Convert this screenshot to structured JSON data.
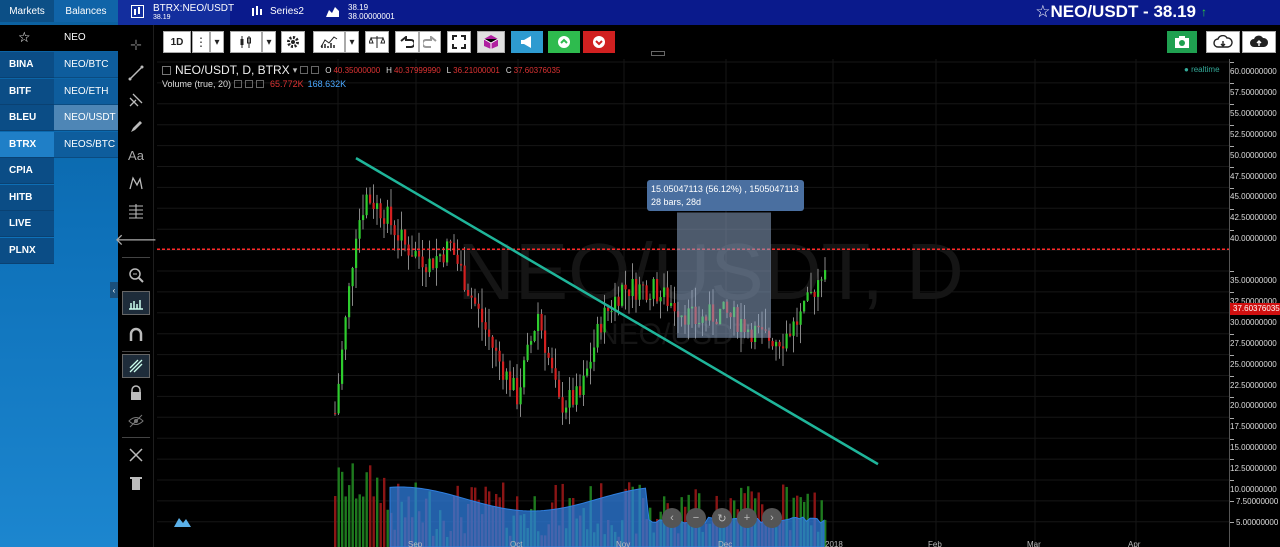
{
  "left_panel": {
    "tabs": [
      "Markets",
      "Balances"
    ],
    "favorites_label": "NEO",
    "exchanges": [
      "BINA",
      "BITF",
      "BLEU",
      "BTRX",
      "CPIA",
      "HITB",
      "LIVE",
      "PLNX"
    ],
    "selected_exchange": "BTRX",
    "pairs": [
      "NEO/BTC",
      "NEO/ETH",
      "NEO/USDT",
      "NEOS/BTC"
    ],
    "selected_pair": "NEO/USDT"
  },
  "top_bar": {
    "symbol_tab": {
      "name": "BTRX:NEO/USDT",
      "price": "38.19"
    },
    "series2_label": "Series2",
    "series3": {
      "value1": "38.19",
      "value2": "38.00000001"
    },
    "title": "NEO/USDT - 38.19"
  },
  "toolbar": {
    "interval": "1D"
  },
  "legend": {
    "symbol": "NEO/USDT, D, BTRX",
    "open_key": "O",
    "open": "40.35000000",
    "high_key": "H",
    "high": "40.37999990",
    "low_key": "L",
    "low": "36.21000001",
    "close_key": "C",
    "close": "37.60376035",
    "volume_label": "Volume (true, 20)",
    "volume_value1": "65.772K",
    "volume_value2": "168.632K"
  },
  "realtime_label": "realtime",
  "watermark": {
    "main": "NEO/USDT, D",
    "sub": "NEO/USDT"
  },
  "measure_tooltip": {
    "line1": "15.05047113 (56.12%) , 1505047113",
    "line2": "28 bars, 28d"
  },
  "price_axis": {
    "labels": [
      "60.00000000",
      "57.50000000",
      "55.00000000",
      "52.50000000",
      "50.00000000",
      "47.50000000",
      "45.00000000",
      "42.50000000",
      "40.00000000",
      "35.00000000",
      "32.50000000",
      "30.00000000",
      "27.50000000",
      "25.00000000",
      "22.50000000",
      "20.00000000",
      "17.50000000",
      "15.00000000",
      "12.50000000",
      "10.00000000",
      "7.50000000",
      "5.00000000"
    ],
    "current_price": "37.60376035"
  },
  "time_axis_labels": [
    "Sep",
    "Oct",
    "Nov",
    "Dec",
    "2018",
    "Feb",
    "Mar",
    "Apr"
  ],
  "colors": {
    "up": "#2ecc2e",
    "down": "#d42020",
    "trendline": "#1fb59a",
    "volume_area": "#2f7fe0",
    "price_line": "#ff2a2a",
    "panel_blue": "#0d70b8",
    "header_blue": "#0a1a8c"
  },
  "icons": {
    "measure": "ruler-icon",
    "magnet": "magnet-icon",
    "lock": "lock-icon",
    "eye": "eye-icon",
    "trash": "trash-icon"
  }
}
